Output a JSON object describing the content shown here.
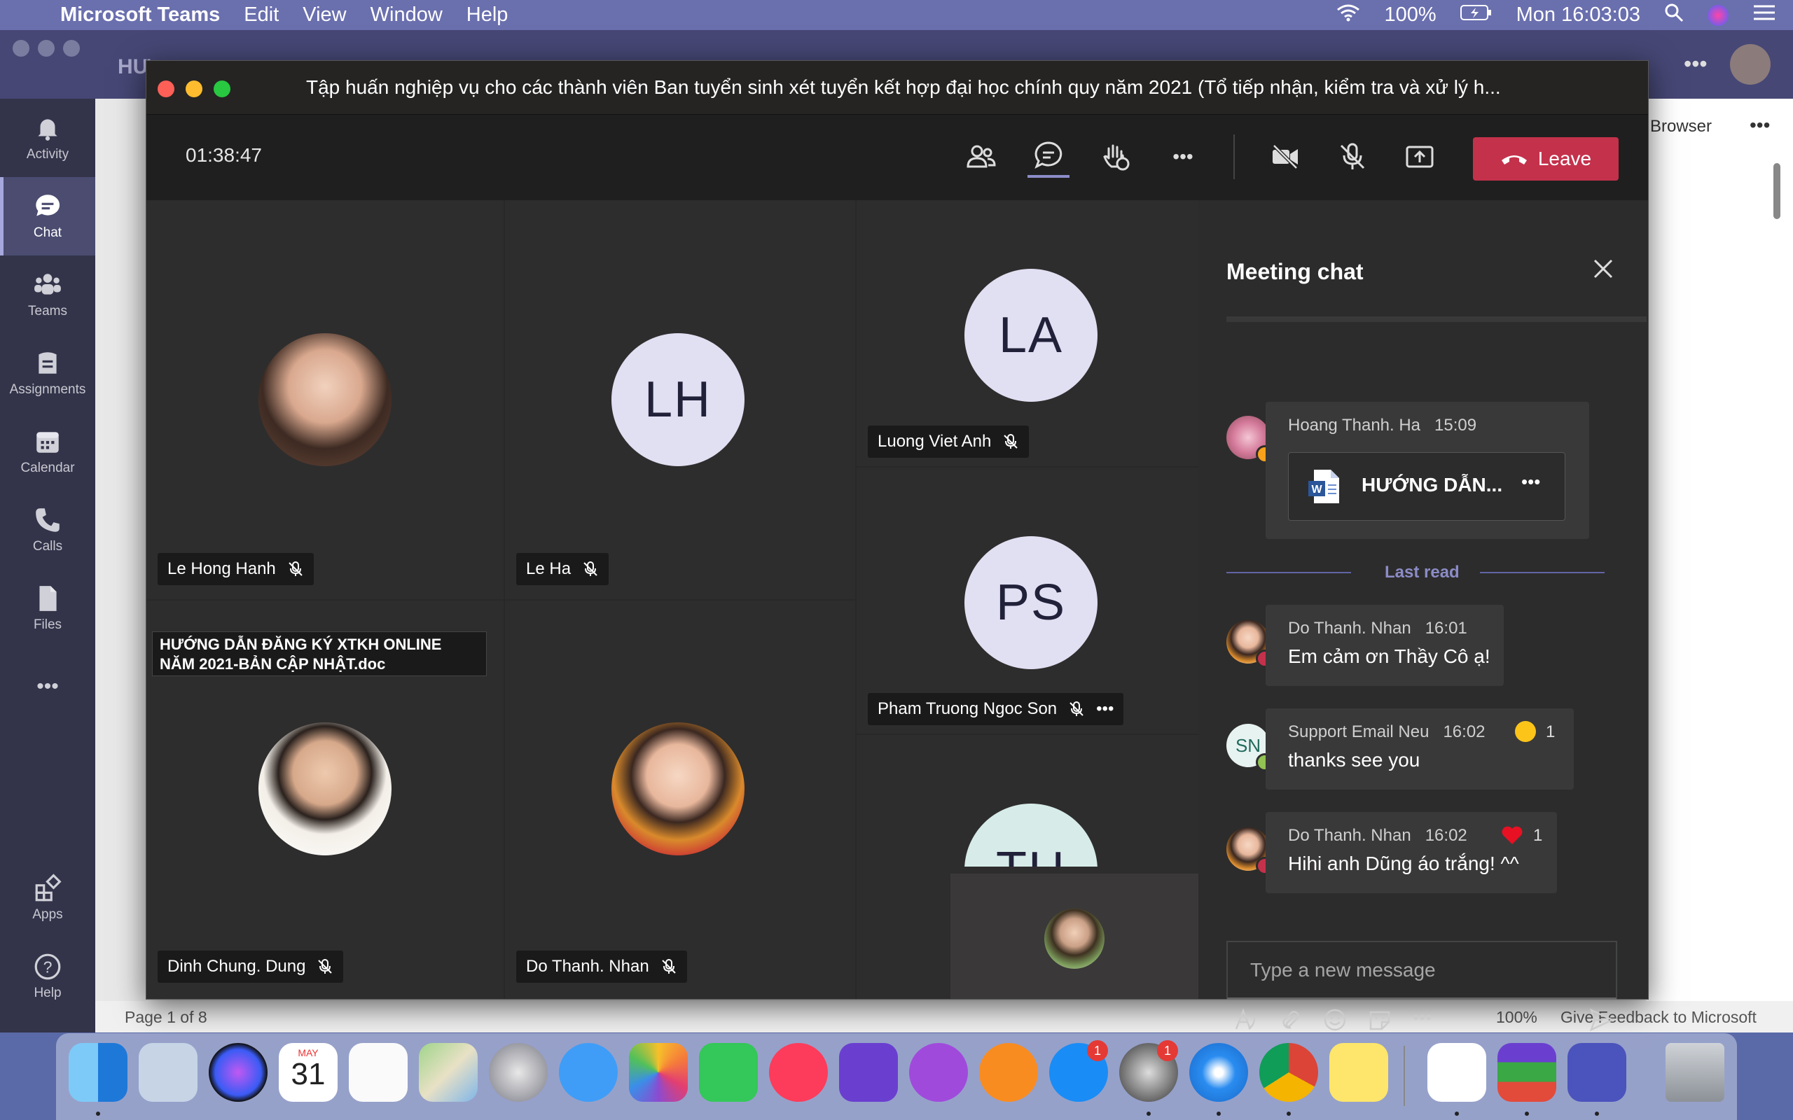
{
  "menubar": {
    "app_name": "Microsoft Teams",
    "menus": [
      "Edit",
      "View",
      "Window",
      "Help"
    ],
    "battery": "100%",
    "clock": "Mon 16:03:03"
  },
  "teams_bg": {
    "doc_title_fragment": "HƯ",
    "browser_label": "Browser",
    "status_page": "Page 1 of 8",
    "status_zoom": "100%",
    "status_feedback": "Give Feedback to Microsoft"
  },
  "rail": {
    "items": [
      {
        "label": "Activity",
        "icon": "bell-icon"
      },
      {
        "label": "Chat",
        "icon": "chat-icon"
      },
      {
        "label": "Teams",
        "icon": "teams-icon"
      },
      {
        "label": "Assignments",
        "icon": "assignments-icon"
      },
      {
        "label": "Calendar",
        "icon": "calendar-icon"
      },
      {
        "label": "Calls",
        "icon": "phone-icon"
      },
      {
        "label": "Files",
        "icon": "file-icon"
      },
      {
        "label": "Apps",
        "icon": "apps-icon"
      },
      {
        "label": "Help",
        "icon": "help-icon"
      }
    ]
  },
  "meeting": {
    "title": "Tập huấn nghiệp vụ cho các thành viên Ban tuyển sinh xét tuyển kết hợp đại học chính quy năm 2021 (Tổ tiếp nhận, kiểm tra và xử lý h...",
    "timer": "01:38:47",
    "leave_label": "Leave",
    "participants": [
      {
        "name": "Le Hong Hanh",
        "initials": ""
      },
      {
        "name": "Le Ha",
        "initials": "LH"
      },
      {
        "name": "Luong Viet Anh",
        "initials": "LA"
      },
      {
        "name": "Pham Truong Ngoc Son",
        "initials": "PS"
      },
      {
        "name": "Dinh Chung. Dung",
        "initials": ""
      },
      {
        "name": "Do Thanh. Nhan",
        "initials": ""
      },
      {
        "name": "",
        "initials": "TH"
      }
    ],
    "shared_doc_caption": "HƯỚNG DẪN ĐĂNG KÝ XTKH ONLINE NĂM 2021-BẢN CẬP NHẬT.doc"
  },
  "chat": {
    "title": "Meeting chat",
    "last_read": "Last read",
    "compose_placeholder": "Type a new message",
    "messages": [
      {
        "sender": "Hoang Thanh. Ha",
        "time": "15:09",
        "file_name": "HƯỚNG DẪN..."
      },
      {
        "sender": "Do Thanh. Nhan",
        "time": "16:01",
        "text": "Em cảm ơn Thầy Cô ạ!"
      },
      {
        "sender": "Support Email Neu",
        "initials": "SN",
        "time": "16:02",
        "text": "thanks see you",
        "reaction_count": "1"
      },
      {
        "sender": "Do Thanh. Nhan",
        "time": "16:02",
        "text": "Hihi anh Dũng áo trắng! ^^",
        "reaction_count": "1"
      }
    ]
  },
  "dock": {
    "calendar_month": "MAY",
    "calendar_day": "31",
    "appstore_badge": "1",
    "settings_badge": "1",
    "apps": [
      "finder",
      "mail",
      "siri",
      "calendar",
      "reminders",
      "maps",
      "launchpad",
      "messages",
      "photos",
      "facetime",
      "music",
      "imovie",
      "podcasts",
      "books",
      "app-store",
      "system-preferences",
      "safari",
      "chrome",
      "notes",
      "word",
      "winrar",
      "teams",
      "trash"
    ]
  },
  "colors": {
    "leave_red": "#c4314b",
    "accent": "#6264a7",
    "rail_bg": "#33344a"
  }
}
